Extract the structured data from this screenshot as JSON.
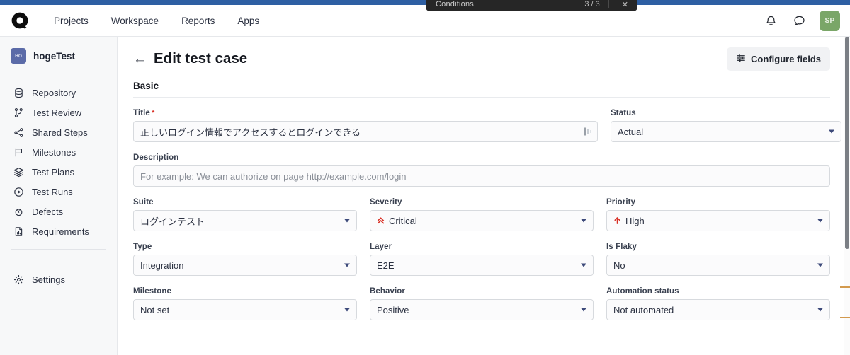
{
  "toast": {
    "title": "Conditions",
    "count": "3 / 3",
    "close": "✕"
  },
  "header": {
    "logo": "qase-logo-icon",
    "nav": [
      {
        "label": "Projects"
      },
      {
        "label": "Workspace"
      },
      {
        "label": "Reports"
      },
      {
        "label": "Apps"
      }
    ],
    "notifications_icon": "bell-icon",
    "messages_icon": "chat-bubble-icon",
    "avatar_initials": "SP",
    "avatar_color": "#7aa668"
  },
  "sidebar": {
    "project": {
      "badge": "HO",
      "name": "hogeTest",
      "badge_color": "#5b6ba8"
    },
    "items": [
      {
        "label": "Repository",
        "icon": "database-icon"
      },
      {
        "label": "Test Review",
        "icon": "git-branch-icon"
      },
      {
        "label": "Shared Steps",
        "icon": "share-nodes-icon"
      },
      {
        "label": "Milestones",
        "icon": "flag-icon"
      },
      {
        "label": "Test Plans",
        "icon": "layers-icon"
      },
      {
        "label": "Test Runs",
        "icon": "play-circle-icon"
      },
      {
        "label": "Defects",
        "icon": "bug-icon"
      },
      {
        "label": "Requirements",
        "icon": "document-chart-icon"
      }
    ],
    "settings": {
      "label": "Settings",
      "icon": "gear-icon"
    }
  },
  "page": {
    "back_icon": "arrow-left-icon",
    "title": "Edit test case",
    "configure_fields": {
      "label": "Configure fields",
      "icon": "sliders-icon"
    },
    "section_basic": "Basic"
  },
  "form": {
    "title": {
      "label": "Title",
      "required": "*",
      "value": "正しいログイン情報でアクセスするとログインできる",
      "trailing_icon": "text-resize-icon"
    },
    "status": {
      "label": "Status",
      "value": "Actual"
    },
    "description": {
      "label": "Description",
      "value": "",
      "placeholder": "For example: We can authorize on page http://example.com/login"
    },
    "suite": {
      "label": "Suite",
      "value": "ログインテスト"
    },
    "severity": {
      "label": "Severity",
      "value": "Critical",
      "icon": "chevron-double-up-icon",
      "icon_color": "#d93025"
    },
    "priority": {
      "label": "Priority",
      "value": "High",
      "icon": "arrow-up-icon",
      "icon_color": "#d93025"
    },
    "type": {
      "label": "Type",
      "value": "Integration"
    },
    "layer": {
      "label": "Layer",
      "value": "E2E"
    },
    "is_flaky": {
      "label": "Is Flaky",
      "value": "No"
    },
    "milestone": {
      "label": "Milestone",
      "value": "Not set"
    },
    "behavior": {
      "label": "Behavior",
      "value": "Positive"
    },
    "automation_status": {
      "label": "Automation status",
      "value": "Not automated"
    }
  }
}
